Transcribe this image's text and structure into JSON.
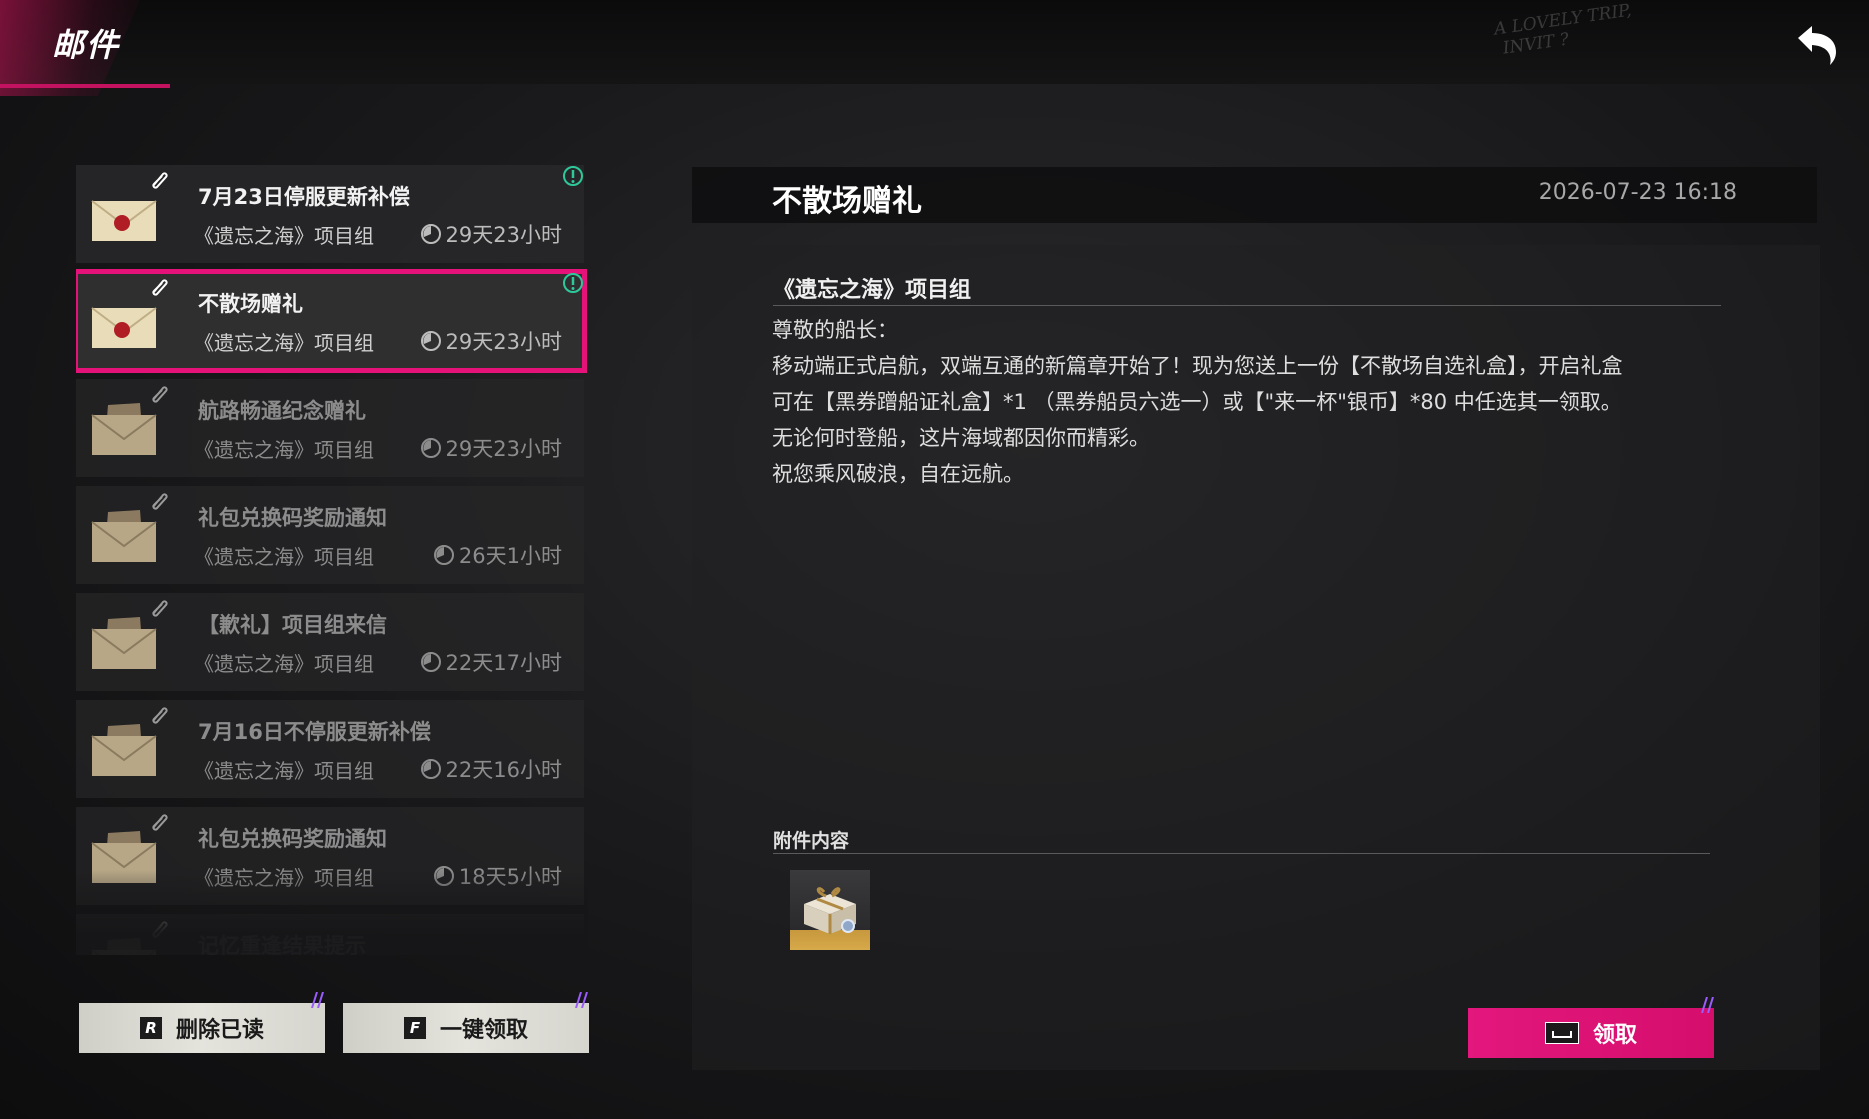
{
  "header": {
    "title": "邮件",
    "watermark_line1": "A LOVELY TRIP,",
    "watermark_line2": "INVIT ?"
  },
  "mails": [
    {
      "title": "7月23日停服更新补偿",
      "sender": "《遗忘之海》项目组",
      "expire": "29天23小时",
      "read": false,
      "selected": false,
      "new": true
    },
    {
      "title": "不散场赠礼",
      "sender": "《遗忘之海》项目组",
      "expire": "29天23小时",
      "read": false,
      "selected": true,
      "new": true
    },
    {
      "title": "航路畅通纪念赠礼",
      "sender": "《遗忘之海》项目组",
      "expire": "29天23小时",
      "read": true,
      "selected": false,
      "new": false
    },
    {
      "title": "礼包兑换码奖励通知",
      "sender": "《遗忘之海》项目组",
      "expire": "26天1小时",
      "read": true,
      "selected": false,
      "new": false
    },
    {
      "title": "【歉礼】项目组来信",
      "sender": "《遗忘之海》项目组",
      "expire": "22天17小时",
      "read": true,
      "selected": false,
      "new": false
    },
    {
      "title": "7月16日不停服更新补偿",
      "sender": "《遗忘之海》项目组",
      "expire": "22天16小时",
      "read": true,
      "selected": false,
      "new": false
    },
    {
      "title": "礼包兑换码奖励通知",
      "sender": "《遗忘之海》项目组",
      "expire": "18天5小时",
      "read": true,
      "selected": false,
      "new": false
    },
    {
      "title": "记忆重逢结果提示",
      "sender": "",
      "expire": "",
      "read": true,
      "selected": false,
      "new": false
    }
  ],
  "buttons": {
    "delete_read": {
      "key": "R",
      "label": "删除已读"
    },
    "claim_all": {
      "key": "F",
      "label": "一键领取"
    },
    "claim": {
      "label": "领取"
    }
  },
  "detail": {
    "title": "不散场赠礼",
    "date": "2026-07-23 16:18",
    "sender": "《遗忘之海》项目组",
    "lines": [
      "尊敬的船长：",
      "移动端正式启航，双端互通的新篇章开始了！现为您送上一份【不散场自选礼盒】，开启礼盒",
      "可在【黑券蹭船证礼盒】*1 （黑券船员六选一）或【\"来一杯\"银币】*80 中任选其一领取。",
      "无论何时登船，这片海域都因你而精彩。",
      "祝您乘风破浪，自在远航。"
    ],
    "attachment_label": "附件内容"
  },
  "colors": {
    "accent": "#e5127a",
    "new_badge": "#2ec99a"
  }
}
